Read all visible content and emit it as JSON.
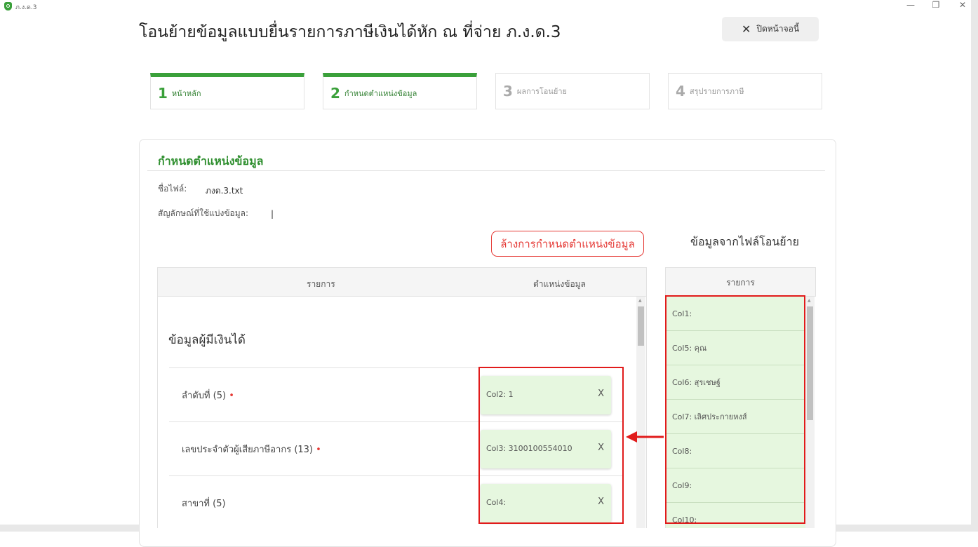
{
  "window": {
    "title": "ภ.ง.ด.3",
    "min": "—",
    "restore": "❐",
    "close": "✕"
  },
  "page_title": "โอนย้ายข้อมูลแบบยื่นรายการภาษีเงินได้หัก ณ ที่จ่าย ภ.ง.ด.3",
  "close_button": {
    "icon": "close-icon",
    "label": "ปิดหน้าจอนี้"
  },
  "steps": [
    {
      "num": "1",
      "label": "หน้าหลัก",
      "active": true
    },
    {
      "num": "2",
      "label": "กำหนดตำแหน่งข้อมูล",
      "active": true
    },
    {
      "num": "3",
      "label": "ผลการโอนย้าย",
      "active": false
    },
    {
      "num": "4",
      "label": "สรุปรายการภาษี",
      "active": false
    }
  ],
  "section": {
    "title": "กำหนดตำแหน่งข้อมูล",
    "file_label": "ชื่อไฟล์:",
    "file_name": "ภงด.3.txt",
    "delimiter_label": "สัญลักษณ์ที่ใช้แบ่งข้อมูล:",
    "delimiter_value": "|"
  },
  "clear_button": "ล้างการกำหนดตำแหน่งข้อมูล",
  "source_title": "ข้อมูลจากไฟล์โอนย้าย",
  "mapping_table": {
    "col_item": "รายการ",
    "col_position": "ตำแหน่งข้อมูล",
    "group_title": "ข้อมูลผู้มีเงินได้",
    "rows": [
      {
        "label": "ลำดับที่ (5)",
        "required": "•",
        "value": "Col2: 1",
        "remove": "X"
      },
      {
        "label": "เลขประจำตัวผู้เสียภาษีอากร (13)",
        "required": "•",
        "value": "Col3: 3100100554010",
        "remove": "X"
      },
      {
        "label": "สาขาที่ (5)",
        "required": "",
        "value": "Col4:",
        "remove": "X"
      }
    ]
  },
  "source_table": {
    "col_item": "รายการ",
    "items": [
      "Col1:",
      "Col5: คุณ",
      "Col6: สุรเชษฐ์",
      "Col7: เลิศประกายหงส์",
      "Col8:",
      "Col9:",
      "Col10:"
    ]
  },
  "colors": {
    "brand": "#3aa03a",
    "alert": "#e53935",
    "slot_bg": "#e6f7df",
    "highlight": "#e11b1b"
  }
}
